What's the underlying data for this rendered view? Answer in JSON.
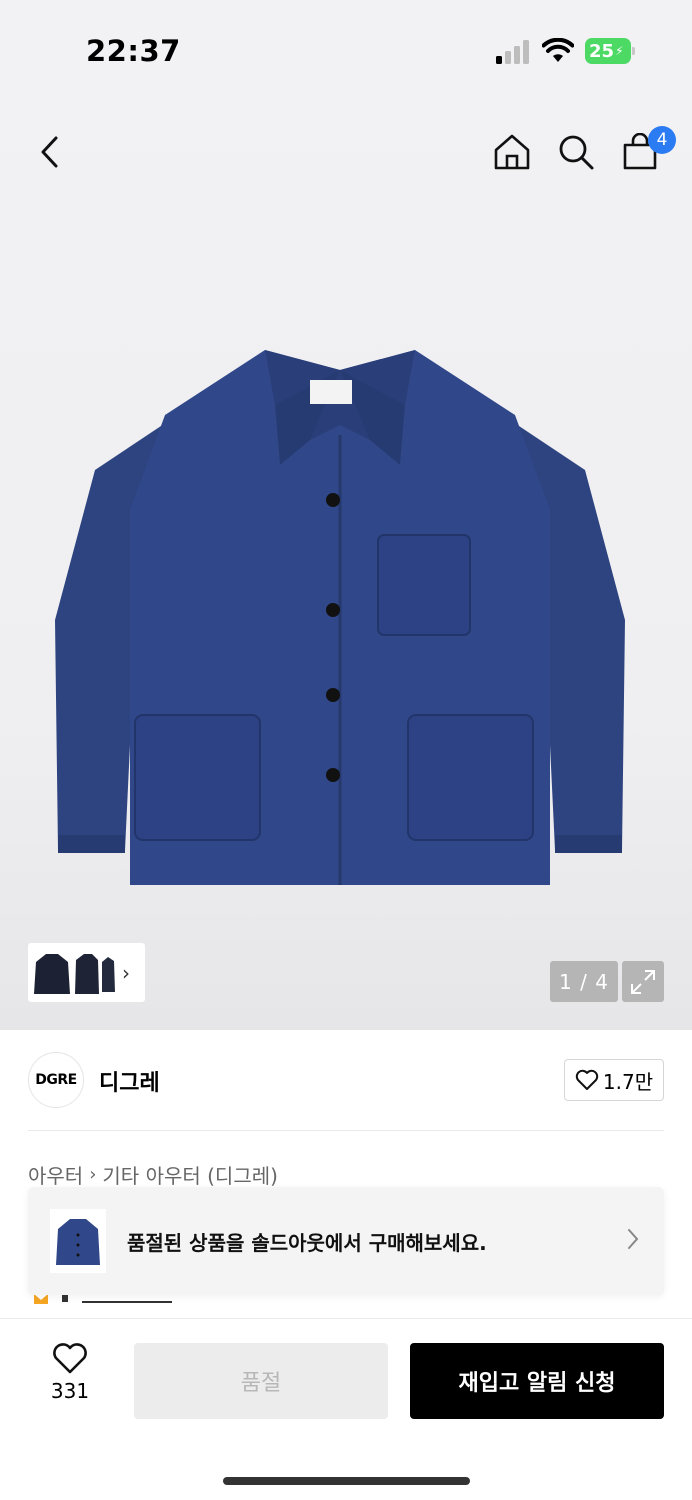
{
  "status_bar": {
    "time": "22:37",
    "battery_level": "25"
  },
  "nav": {
    "cart_count": "4"
  },
  "gallery": {
    "page_indicator": "1 / 4",
    "current_page": 1,
    "total_pages": 4
  },
  "brand": {
    "logo_text": "DGRE",
    "name": "디그레",
    "like_count": "1.7만"
  },
  "breadcrumb": {
    "category": "아우터",
    "subcategory": "기타 아우터 (디그레)"
  },
  "notice": {
    "text": "품절된 상품을 솔드아웃에서 구매해보세요."
  },
  "bottom_bar": {
    "wish_count": "331",
    "soldout_label": "품절",
    "restock_label": "재입고 알림 신청"
  },
  "colors": {
    "accent_blue": "#2b7bf2",
    "battery_green": "#4cd964",
    "jacket_navy": "#2e4480"
  }
}
